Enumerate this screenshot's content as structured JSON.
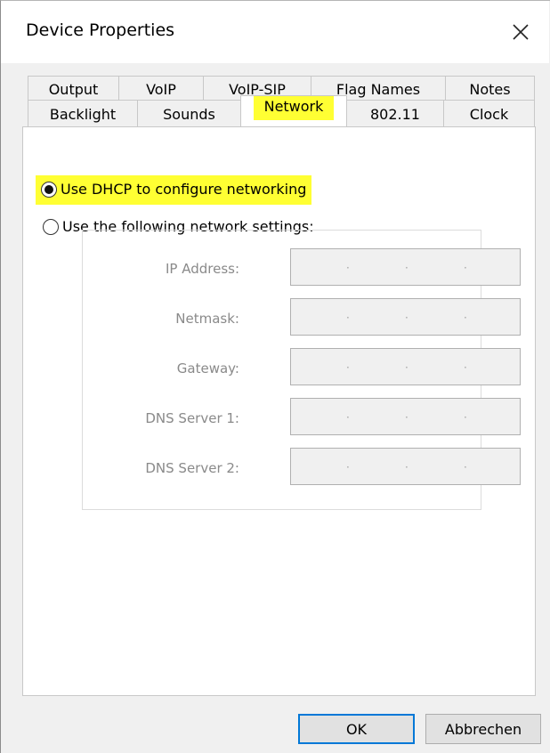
{
  "window": {
    "title": "Device Properties",
    "close_icon": "close-icon"
  },
  "tabs": {
    "row1": [
      {
        "label": "Output"
      },
      {
        "label": "VoIP"
      },
      {
        "label": "VoIP-SIP"
      },
      {
        "label": "Flag Names"
      },
      {
        "label": "Notes"
      }
    ],
    "row2": [
      {
        "label": "Backlight"
      },
      {
        "label": "Sounds"
      },
      {
        "label": "Network",
        "active": true,
        "highlight": "#ffff33"
      },
      {
        "label": "802.11"
      },
      {
        "label": "Clock"
      }
    ]
  },
  "network": {
    "dhcp_label": "Use DHCP to configure networking",
    "dhcp_selected": true,
    "manual_label": "Use the following network settings:",
    "manual_selected": false,
    "fields": [
      {
        "label": "IP Address:",
        "dots": "·  ·  ·"
      },
      {
        "label": "Netmask:",
        "dots": "·  ·  ·"
      },
      {
        "label": "Gateway:",
        "dots": "·  ·  ·"
      },
      {
        "label": "DNS Server 1:",
        "dots": "·  ·  ·"
      },
      {
        "label": "DNS Server 2:",
        "dots": "·  ·  ·"
      }
    ],
    "highlight_color": "#ffff33"
  },
  "buttons": {
    "ok": "OK",
    "cancel": "Abbrechen"
  },
  "colors": {
    "accent": "#0078d7",
    "highlight": "#ffff33",
    "disabled_text": "#8a8a8a"
  }
}
